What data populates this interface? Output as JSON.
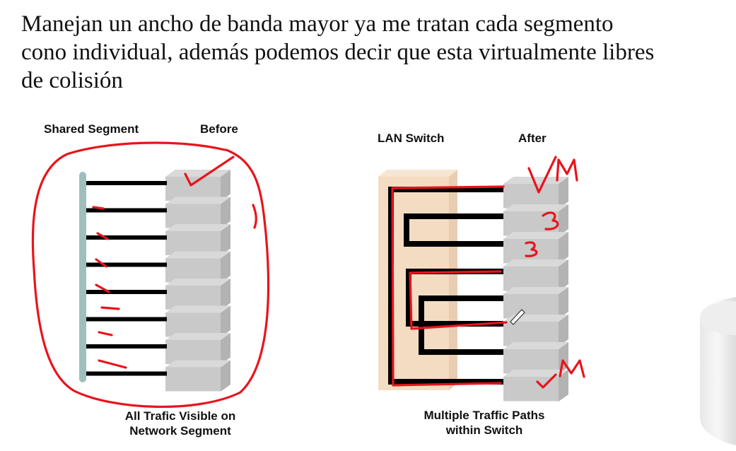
{
  "slide": {
    "heading_lines": [
      "Manejan un ancho de banda  mayor  ya me tratan cada segmento",
      "cono individual, además podemos decir que esta  virtualmente libres",
      "de colisión"
    ]
  },
  "left_diagram": {
    "label_segment": "Shared Segment",
    "label_state": "Before",
    "caption_line1": "All Trafic Visible on",
    "caption_line2": "Network Segment"
  },
  "right_diagram": {
    "label_switch": "LAN Switch",
    "label_state": "After",
    "caption_line1": "Multiple Traffic Paths",
    "caption_line2": "within Switch"
  },
  "annotations": {
    "ink_color": "#e8141c",
    "marks": [
      "VM",
      "3",
      "3",
      "M"
    ]
  },
  "colors": {
    "bus": "#9fbfbf",
    "cable": "#000000",
    "port_face": "#c9c9c9",
    "port_shade": "#b3b3b3",
    "switch_body": "#f3dcc2"
  }
}
